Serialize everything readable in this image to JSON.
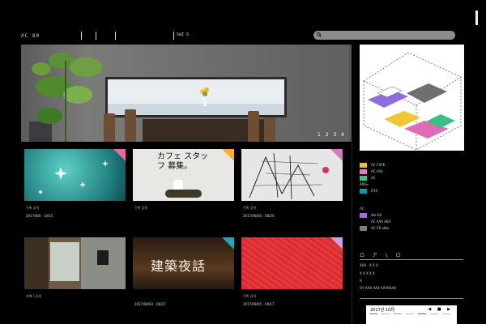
{
  "header": {
    "logo": "ΛC 80",
    "nav_label": "SeΣ S",
    "search_placeholder": ""
  },
  "hero": {
    "pager": "1 2 3 4"
  },
  "cards": [
    {
      "cat": "건축 공개",
      "date": "2017/8/8 - 10/15",
      "corner": "#e86aa0"
    },
    {
      "cat": "건축 공개 ",
      "date": "",
      "corner": "#f5b324"
    },
    {
      "cat": "건축 공개",
      "date": "2017/08/05 - 08/20",
      "corner": "#d07cc4"
    },
    {
      "cat": "카페 / 공개 ",
      "date": "",
      "corner": ""
    },
    {
      "cat": "",
      "date": "2017/08/03 - 08/27",
      "corner": "#1aa8bd"
    },
    {
      "cat": "건축 공개",
      "date": "2017/08/05 - 09/17",
      "corner": "#c9a0e0"
    }
  ],
  "card_texts": {
    "cafe_staff": "カフェ スタッフ 募集。",
    "architecture_night": "建築夜話"
  },
  "legend": [
    {
      "label": "ΛC CAFE",
      "color": "#f3b93a"
    },
    {
      "label": "ΛC ΛΛΕ",
      "color": "#e07cc0"
    },
    {
      "label": "ΛC",
      "color": "#3fbf8a"
    },
    {
      "label": "400ㅠ",
      "color": ""
    },
    {
      "label": "ΟΥΛ",
      "color": "#1f8fb5"
    }
  ],
  "legend2": [
    {
      "label": "ΛC",
      "color": ""
    },
    {
      "label": "Ver-ΛΛ",
      "color": "#9b6fe0"
    },
    {
      "label": "ΛC ΛΛΧ ΛΕΛ",
      "color": ""
    },
    {
      "label": "ΛC ΣΧ udio",
      "color": "#7c7c7c"
    }
  ],
  "sidebar_text": {
    "heading": "ロ ア \\ ロ",
    "line1": "ΧΧΧ · Χ Χ Χ",
    "line2": "Χ Χ Χ   Χ Χ",
    "line3": "Χ",
    "line4": "ΟΥ ΛΛΧ ΛΛΧ ΛΛΥΟΛΛΧ"
  },
  "calendar": {
    "title": "2017년 10月",
    "nav": "◀ ■ ▶"
  }
}
